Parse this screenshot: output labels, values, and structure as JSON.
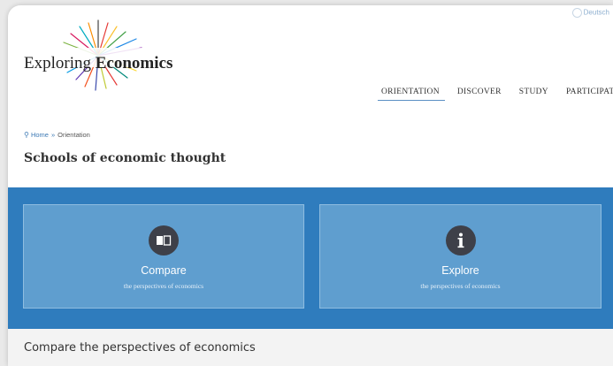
{
  "header": {
    "language_label": "Deutsch",
    "logo_text_regular": "Exploring ",
    "logo_text_bold": "Economics"
  },
  "nav": {
    "items": [
      {
        "label": "ORIENTATION",
        "active": true
      },
      {
        "label": "DISCOVER",
        "active": false
      },
      {
        "label": "STUDY",
        "active": false
      },
      {
        "label": "PARTICIPATE",
        "active": false
      }
    ]
  },
  "breadcrumb": {
    "home": "Home",
    "separator": "»",
    "current": "Orientation"
  },
  "page": {
    "title": "Schools of economic thought"
  },
  "cards": [
    {
      "title": "Compare",
      "subtitle": "the perspectives of economics",
      "icon": "compare-icon"
    },
    {
      "title": "Explore",
      "subtitle": "the perspectives of economics",
      "icon": "info-icon"
    }
  ],
  "section": {
    "heading": "Compare the perspectives of economics"
  },
  "colors": {
    "band": "#2f7cbd",
    "card": "#5f9ecf",
    "icon_circle": "#3e4049",
    "link": "#3d7ab5"
  }
}
